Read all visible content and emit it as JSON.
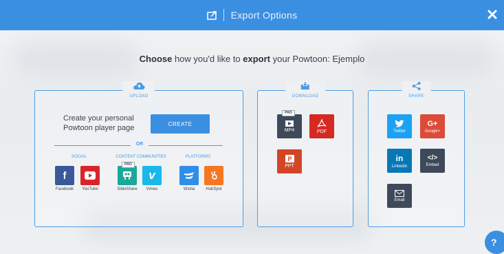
{
  "header": {
    "title": "Export Options"
  },
  "prompt": {
    "w1": "Choose",
    "t1": " how you'd like to ",
    "w2": "export",
    "t2": " your Powtoon: Ejemplo"
  },
  "upload": {
    "label": "UPLOAD",
    "player_text_1": "Create your personal",
    "player_text_2": "Powtoon player page",
    "create_label": "CREATE",
    "or_label": "OR",
    "categories": [
      "SOCIAL",
      "CONTENT COMMUNITIES",
      "PLATFORMS"
    ],
    "tiles": [
      "Facebook",
      "YouTube",
      "SlideShare",
      "Vimeo",
      "Wistia",
      "HubSpot"
    ],
    "pro_badge": "PRO"
  },
  "download": {
    "label": "DOWNLOAD",
    "pro_badge": "PRO",
    "tiles": [
      "MP4",
      "PDF",
      "PPT"
    ]
  },
  "share": {
    "label": "SHARE",
    "tiles": [
      "Twitter",
      "Google+",
      "Linkedin",
      "Embed",
      "Email"
    ]
  },
  "icons": {
    "twitter_glyph": "🐦",
    "gplus_glyph": "G+",
    "linkedin_glyph": "in",
    "embed_glyph": "</>",
    "facebook_glyph": "f",
    "vimeo_glyph": "v",
    "help_glyph": "?"
  },
  "colors": {
    "accent": "#3b8fe0",
    "facebook": "#3b5998",
    "youtube": "#d9252a",
    "slideshare": "#1ba89a",
    "vimeo": "#1ab7ea",
    "wistia": "#2f8ee8",
    "hubspot": "#f57722",
    "mp4": "#3e4a5a",
    "pdf": "#d42a22",
    "ppt": "#d24625",
    "twitter": "#1da1f2",
    "gplus": "#dc4a38",
    "linkedin": "#0a77b5",
    "embed": "#3e4a5a",
    "email": "#3e4a5a"
  }
}
